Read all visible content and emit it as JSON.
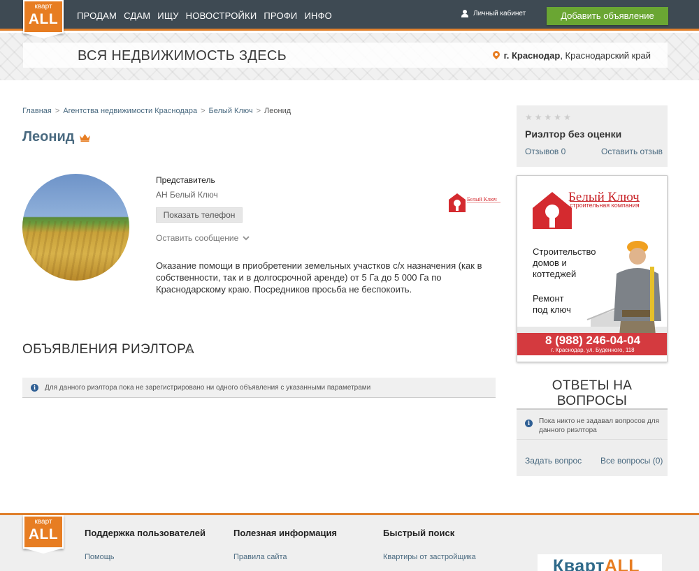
{
  "logo": {
    "small": "кварт",
    "big": "ALL"
  },
  "nav": {
    "items": [
      "ПРОДАМ",
      "СДАМ",
      "ИЩУ",
      "НОВОСТРОЙКИ",
      "ПРОФИ",
      "ИНФО"
    ]
  },
  "header": {
    "cabinet": "Личный кабинет",
    "add_button": "Добавить объявление"
  },
  "banner": {
    "title": "ВСЯ НЕДВИЖИМОСТЬ ЗДЕСЬ",
    "city": "г. Краснодар",
    "region": ", Краснодарский край"
  },
  "breadcrumb": [
    "Главная",
    "Агентства недвижимости Краснодара",
    "Белый Ключ",
    "Леонид"
  ],
  "breadcrumb_sep": ">",
  "agent": {
    "name": "Леонид",
    "rep_label": "Представитель",
    "agency": "АН Белый Ключ",
    "phone_button": "Показать телефон",
    "message_link": "Оставить сообщение",
    "description": "Оказание помощи в приобретении земельных участков с/х назначения (как в собственности, так и в долгосрочной аренде) от 5 Га до 5 000 Га по Краснодарскому краю. Посредников просьба не беспокоить."
  },
  "listings": {
    "title": "ОБЪЯВЛЕНИЯ РИЭЛТОРА",
    "count": "0",
    "notice": "Для данного риэлтора пока не зарегистрировано ни одного объявления с указанными параметрами"
  },
  "rating": {
    "title": "Риэлтор без оценки",
    "reviews": "Отзывов 0",
    "leave_review": "Оставить отзыв",
    "stars_filled": 0,
    "stars_total": 5
  },
  "ad": {
    "brand": "Белый Ключ",
    "brand_sub": "строительная компания",
    "line1": "Строительство",
    "line2": "домов и",
    "line3": "коттеджей",
    "line4": "Ремонт",
    "line5": "под ключ",
    "phone": "8 (988) 246-04-04",
    "address": "г. Краснодар, ул. Буденного, 118"
  },
  "qa": {
    "title": "ОТВЕТЫ НА ВОПРОСЫ",
    "notice": "Пока никто не задавал вопросов для данного риэлтора",
    "ask": "Задать вопрос",
    "all": "Все вопросы (0)"
  },
  "footer": {
    "col1": {
      "head": "Поддержка пользователей",
      "link": "Помощь"
    },
    "col2": {
      "head": "Полезная информация",
      "link": "Правила сайта"
    },
    "col3": {
      "head": "Быстрый поиск",
      "link": "Квартиры от застройщика"
    },
    "banner_a": "Кварт",
    "banner_b": "ALL"
  },
  "colors": {
    "header_bg": "#3e4a53",
    "accent": "#e77d22",
    "add_button": "#6aa633",
    "link": "#4a6a80",
    "ad_red": "#c9252a"
  }
}
